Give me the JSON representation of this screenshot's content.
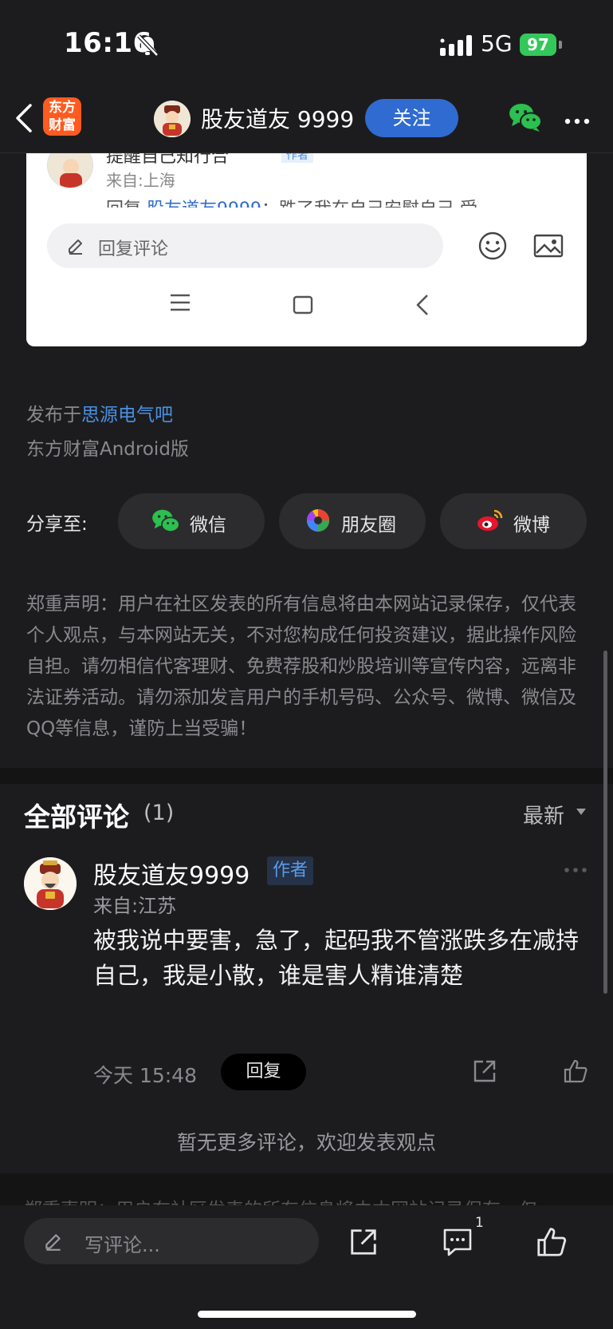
{
  "status_bar": {
    "time": "16:16",
    "network": "5G",
    "battery": "97"
  },
  "nav": {
    "logo_line1": "东方",
    "logo_line2": "财富",
    "username": "股友道友 9999",
    "follow_label": "关注"
  },
  "reply_card": {
    "name": "提醒自己知行合",
    "badge": "作者",
    "location": "来自:上海",
    "reply_prefix": "回复 ",
    "reply_user": "股友道友9999",
    "reply_text": "：跌了我在自己安慰自己 受",
    "input_placeholder": "回复评论"
  },
  "post_meta": {
    "published_prefix": "发布于",
    "forum": "思源电气吧",
    "client": "东方财富Android版"
  },
  "share": {
    "label": "分享至:",
    "options": [
      "微信",
      "朋友圈",
      "微博"
    ]
  },
  "disclaimer": "郑重声明：用户在社区发表的所有信息将由本网站记录保存，仅代表个人观点，与本网站无关，不对您构成任何投资建议，据此操作风险自担。请勿相信代客理财、免费荐股和炒股培训等宣传内容，远离非法证券活动。请勿添加发言用户的手机号码、公众号、微博、微信及QQ等信息，谨防上当受骗！",
  "comments": {
    "title": "全部评论",
    "count": "(1)",
    "sort": "最新",
    "items": [
      {
        "user": "股友道友9999",
        "badge": "作者",
        "location": "来自:江苏",
        "text": "被我说中要害，急了，起码我不管涨跌多在减持自己，我是小散，谁是害人精谁清楚",
        "time": "今天 15:48",
        "reply_label": "回复"
      }
    ],
    "no_more": "暂无更多评论，欢迎发表观点"
  },
  "ghost_disclaimer": "郑重声明：用户在社区发表的所有信息将由本网站记录保存，仅",
  "bottom_bar": {
    "placeholder": "写评论...",
    "comment_count": "1"
  },
  "colors": {
    "background": "#1c1c1e",
    "accent_blue": "#2f6bd1",
    "link_blue": "#4a90e2",
    "battery_green": "#34c759",
    "logo_orange": "#ff5a1f"
  },
  "icons": [
    "bell-slash-icon",
    "signal-icon",
    "back-icon",
    "wechat-icon",
    "more-icon",
    "pencil-icon",
    "emoji-icon",
    "image-icon",
    "menu-icon",
    "home-square-icon",
    "chevron-left-icon",
    "moments-icon",
    "weibo-icon",
    "caret-down-icon",
    "share-icon",
    "like-icon",
    "comment-icon"
  ]
}
